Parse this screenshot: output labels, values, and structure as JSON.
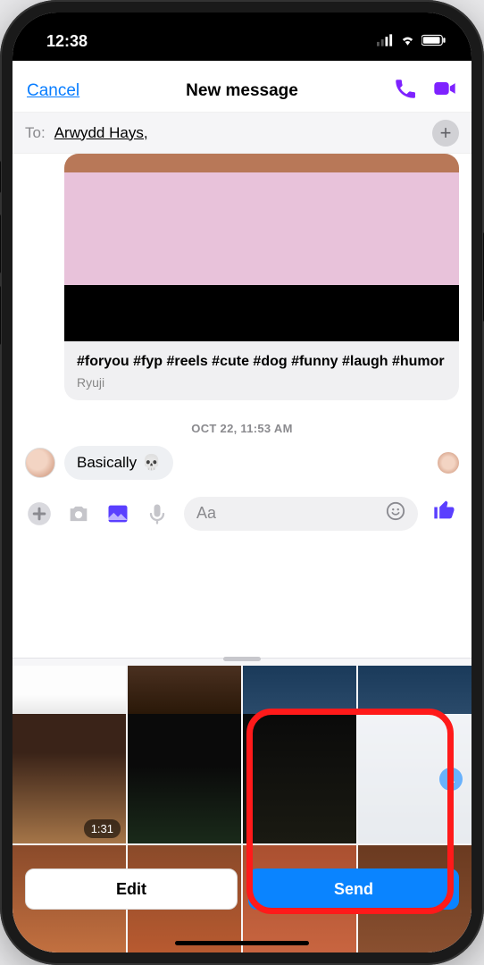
{
  "status": {
    "time": "12:38"
  },
  "nav": {
    "cancel": "Cancel",
    "title": "New message"
  },
  "to": {
    "label": "To:",
    "name": "Arwydd Hays,"
  },
  "sharedCard": {
    "tags": "#foryou #fyp #reels #cute #dog #funny #laugh #humor",
    "author": "Ryuji"
  },
  "timestamp": "OCT 22, 11:53 AM",
  "message": {
    "text": "Basically",
    "emoji": "💀"
  },
  "composer": {
    "placeholder": "Aa"
  },
  "picker": {
    "videoDuration": "1:31",
    "selectedCount": "1",
    "editLabel": "Edit",
    "sendLabel": "Send"
  }
}
